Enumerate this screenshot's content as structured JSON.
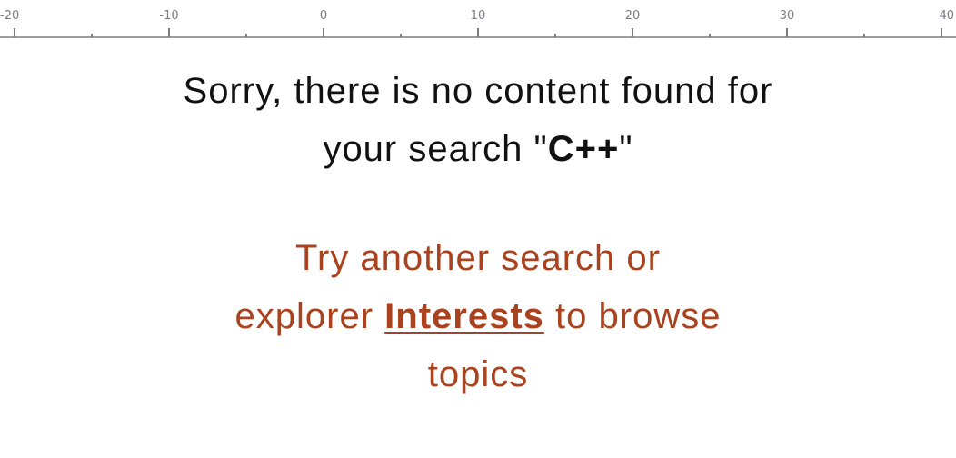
{
  "ruler": {
    "ticks": [
      {
        "value": -20,
        "label": "-20"
      },
      {
        "value": -10,
        "label": "-10"
      },
      {
        "value": 0,
        "label": "0"
      },
      {
        "value": 10,
        "label": "10"
      },
      {
        "value": 20,
        "label": "20"
      },
      {
        "value": 30,
        "label": "30"
      },
      {
        "value": 40,
        "label": "40"
      }
    ],
    "minor_step": 5,
    "color": "#7b7b86"
  },
  "empty_state": {
    "line1": "Sorry, there is no content found for",
    "line2_prefix": "your search \"",
    "query": "C++",
    "line2_suffix": "\"",
    "text_color": "#111111"
  },
  "suggestion": {
    "line1": "Try another search or",
    "line2_prefix": "explorer ",
    "link_label": "Interests",
    "line2_suffix": " to browse",
    "line3": "topics",
    "accent_color": "#a8421f"
  }
}
